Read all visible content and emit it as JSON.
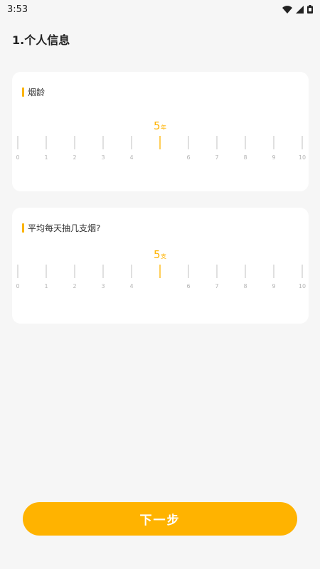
{
  "status_bar": {
    "time": "3:53",
    "icons": [
      "wifi-icon",
      "signal-icon",
      "battery-icon"
    ]
  },
  "page_title": "1.个人信息",
  "accent_color": "#ffb300",
  "cards": [
    {
      "label": "烟龄",
      "ruler": {
        "ticks": [
          "0",
          "1",
          "2",
          "3",
          "4",
          "5",
          "6",
          "7",
          "8",
          "9",
          "10"
        ],
        "selected_value": 5,
        "unit": "年"
      }
    },
    {
      "label": "平均每天抽几支烟?",
      "ruler": {
        "ticks": [
          "0",
          "1",
          "2",
          "3",
          "4",
          "5",
          "6",
          "7",
          "8",
          "9",
          "10"
        ],
        "selected_value": 5,
        "unit": "支"
      }
    }
  ],
  "next_button_label": "下一步"
}
